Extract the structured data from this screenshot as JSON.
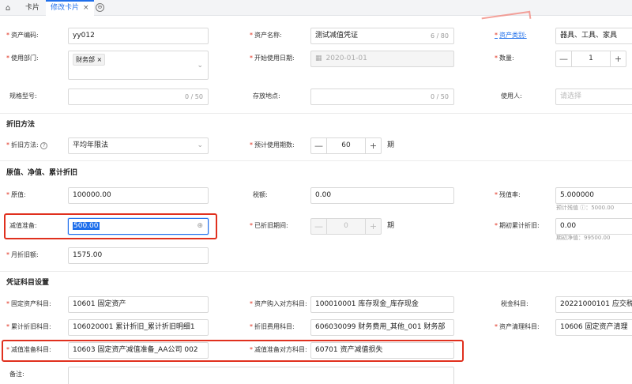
{
  "tabs": {
    "home_icon": "home-icon",
    "items": [
      {
        "label": "卡片"
      },
      {
        "label": "修改卡片"
      }
    ],
    "close_glyph": "×",
    "more_glyph": "⊙"
  },
  "basic": {
    "asset_code": {
      "label": "资产编码:",
      "value": "yy012"
    },
    "asset_name": {
      "label": "资产名称:",
      "value": "测试减值凭证",
      "count": "6 / 80"
    },
    "asset_category": {
      "label": "资产类别:",
      "value": "器具、工具、家具"
    },
    "department": {
      "label": "使用部门:",
      "tag": "财务部",
      "tag_close": "×"
    },
    "start_date": {
      "label": "开始使用日期:",
      "value": "2020-01-01"
    },
    "quantity": {
      "label": "数量:",
      "value": "1",
      "minus": "—",
      "plus": "+"
    },
    "spec": {
      "label": "规格型号:",
      "count": "0 / 50"
    },
    "location": {
      "label": "存放地点:",
      "count": "0 / 50"
    },
    "user": {
      "label": "使用人:",
      "placeholder": "请选择"
    }
  },
  "depreciation": {
    "title": "折旧方法",
    "method": {
      "label": "折旧方法:",
      "value": "平均年限法"
    },
    "period": {
      "label": "预计使用期数:",
      "value": "60",
      "unit": "期",
      "minus": "—",
      "plus": "+"
    }
  },
  "values": {
    "title": "原值、净值、累计折旧",
    "original": {
      "label": "原值:",
      "value": "100000.00"
    },
    "tax": {
      "label": "税额:",
      "value": "0.00"
    },
    "residual_rate": {
      "label": "残值率:",
      "value": "5.000000",
      "hint": "预计残值 ⓘ：5000.00"
    },
    "impairment": {
      "label": "减值准备:",
      "value": "500.00"
    },
    "depreciated_periods": {
      "label": "已折旧期间:",
      "value": "0",
      "unit": "期",
      "minus": "—",
      "plus": "+"
    },
    "opening_accum": {
      "label": "期初累计折旧:",
      "value": "0.00",
      "hint": "期初净值：99500.00"
    },
    "monthly": {
      "label": "月折旧额:",
      "value": "1575.00"
    }
  },
  "voucher": {
    "title": "凭证科目设置",
    "fixed_asset": {
      "label": "固定资产科目:",
      "value": "10601 固定资产"
    },
    "purchase": {
      "label": "资产购入对方科目:",
      "value": "100010001 库存现金_库存现金"
    },
    "tax_subject": {
      "label": "税金科目:",
      "value": "20221000101 应交税费_"
    },
    "accum_dep": {
      "label": "累计折旧科目:",
      "value": "106020001 累计折旧_累计折旧明细1"
    },
    "dep_expense": {
      "label": "折旧费用科目:",
      "value": "606030099 财务费用_其他_001 财务部"
    },
    "cleanup": {
      "label": "资产清理科目:",
      "value": "10606 固定资产清理"
    },
    "impairment_subject": {
      "label": "减值准备科目:",
      "value": "10603 固定资产减值准备_AA公司 002"
    },
    "impairment_counter": {
      "label": "减值准备对方科目:",
      "value": "60701 资产减值损失"
    },
    "remark": {
      "label": "备注:"
    }
  }
}
